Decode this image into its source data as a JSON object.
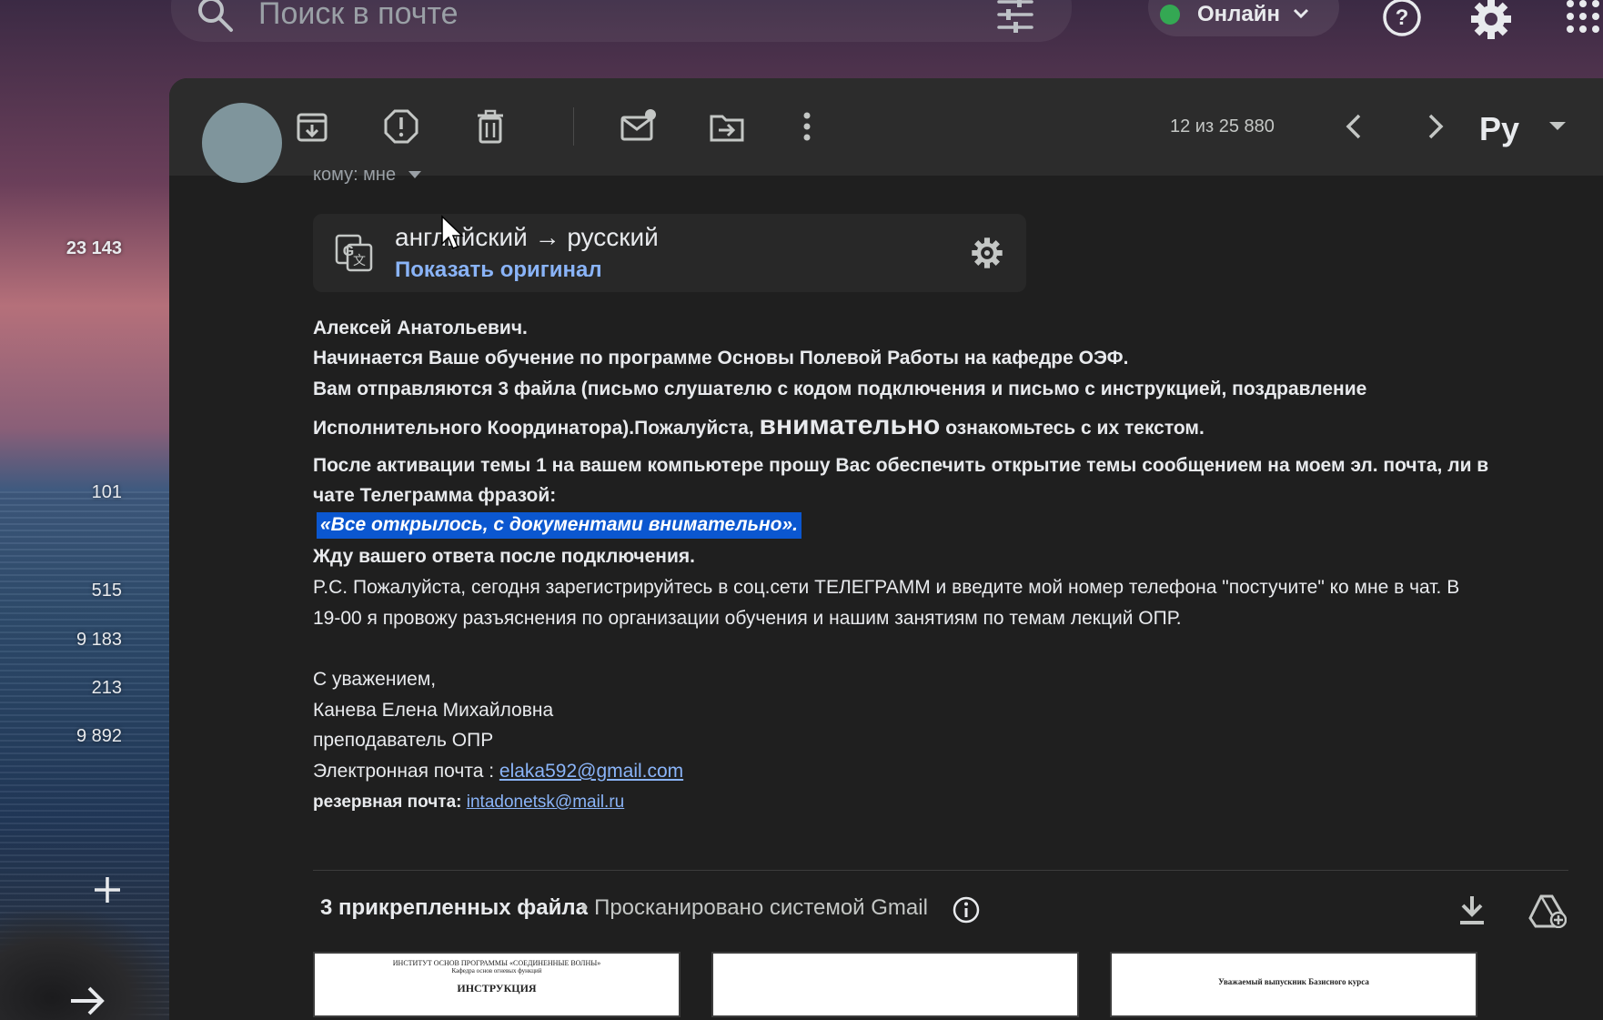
{
  "search": {
    "placeholder": "Поиск в почте"
  },
  "status": {
    "label": "Онлайн"
  },
  "rail": {
    "counts": [
      "23 143",
      "101",
      "515",
      "9 183",
      "213",
      "9 892"
    ]
  },
  "toolbar": {
    "counter": "12 из 25 880",
    "language": "Ру"
  },
  "message": {
    "to_label": "кому: мне",
    "translation": {
      "direction": "английский → русский",
      "show_original": "Показать оригинал"
    },
    "lines": {
      "l1": "Алексей Анатольевич.",
      "l2": "Начинается Ваше обучение по программе Основы Полевой Работы на кафедре ОЭФ.",
      "l3": "Вам отправляются 3 файла (письмо слушателю с кодом подключения и письмо с инструкцией, поздравление",
      "l4a": "Исполнительного Координатора).Пожалуйста, ",
      "l4b": "внимательно",
      "l4c": " ознакомьтесь с их текстом.",
      "l5": "После активации темы 1 на вашем компьютере прошу Вас обеспечить открытие темы сообщением на моем эл. почта, ли в",
      "l6": "чате Телеграмма фразой:",
      "l7": "«Все открылось, с документами внимательно».",
      "l8": "Жду вашего ответа после подключения.",
      "l9": "P.С. Пожалуйста, сегодня зарегистрируйтесь в соц.сети ТЕЛЕГРАММ и введите мой номер телефона \"постучите\" ко мне в чат. В",
      "l10": "19-00 я провожу разъяснения по организации обучения и нашим занятиям по темам лекций ОПР.",
      "l11": "С уважением,",
      "l12": "Канева Елена Михайловна",
      "l13": "преподаватель ОПР",
      "l14_label": "Электронная почта : ",
      "l14_email": "elaka592@gmail.com",
      "l15_label": "резервная почта: ",
      "l15_email": "intadonetsk@mail.ru"
    }
  },
  "attachments": {
    "title": "3 прикрепленных файла",
    "scan_note": "• Просканировано системой Gmail",
    "thumbs": [
      {
        "line1": "ИНСТИТУТ ОСНОВ ПРОГРАММЫ «СОЕДИНЕННЫЕ ВОЛНЫ»",
        "line2": "Кафедра основ огневых функций",
        "line3": "ИНСТРУКЦИЯ"
      },
      {
        "line1": "",
        "line2": "",
        "line3": ""
      },
      {
        "line1": "",
        "line2": "",
        "line3": "Уважаемый выпускник Базисного курса"
      }
    ]
  },
  "colors": {
    "accent_link": "#8ab4f8",
    "highlight": "#0b57d0",
    "online": "#34a853",
    "panel": "#1f1f1f"
  }
}
